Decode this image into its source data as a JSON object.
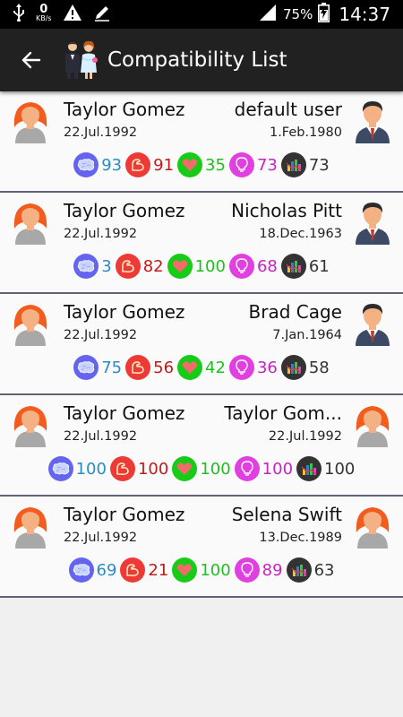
{
  "status_bar": {
    "net_speed": "0",
    "net_unit": "KB/s",
    "battery": "75%",
    "time": "14:37"
  },
  "app_bar": {
    "title": "Compatibility List"
  },
  "rows": [
    {
      "left_name": "Taylor Gomez",
      "left_date": "22.Jul.1992",
      "right_name": "default user",
      "right_date": "1.Feb.1980",
      "right_avatar": "male",
      "mind": "93",
      "physical": "91",
      "love": "35",
      "idea": "73",
      "average": "73"
    },
    {
      "left_name": "Taylor Gomez",
      "left_date": "22.Jul.1992",
      "right_name": "Nicholas Pitt",
      "right_date": "18.Dec.1963",
      "right_avatar": "male",
      "mind": "3",
      "physical": "82",
      "love": "100",
      "idea": "68",
      "average": "61"
    },
    {
      "left_name": "Taylor Gomez",
      "left_date": "22.Jul.1992",
      "right_name": "Brad Cage",
      "right_date": "7.Jan.1964",
      "right_avatar": "male",
      "mind": "75",
      "physical": "56",
      "love": "42",
      "idea": "36",
      "average": "58"
    },
    {
      "left_name": "Taylor Gomez",
      "left_date": "22.Jul.1992",
      "right_name": "Taylor Gom...",
      "right_date": "22.Jul.1992",
      "right_avatar": "female",
      "mind": "100",
      "physical": "100",
      "love": "100",
      "idea": "100",
      "average": "100"
    },
    {
      "left_name": "Taylor Gomez",
      "left_date": "22.Jul.1992",
      "right_name": "Selena Swift",
      "right_date": "13.Dec.1989",
      "right_avatar": "female",
      "mind": "69",
      "physical": "21",
      "love": "100",
      "idea": "89",
      "average": "63"
    }
  ]
}
